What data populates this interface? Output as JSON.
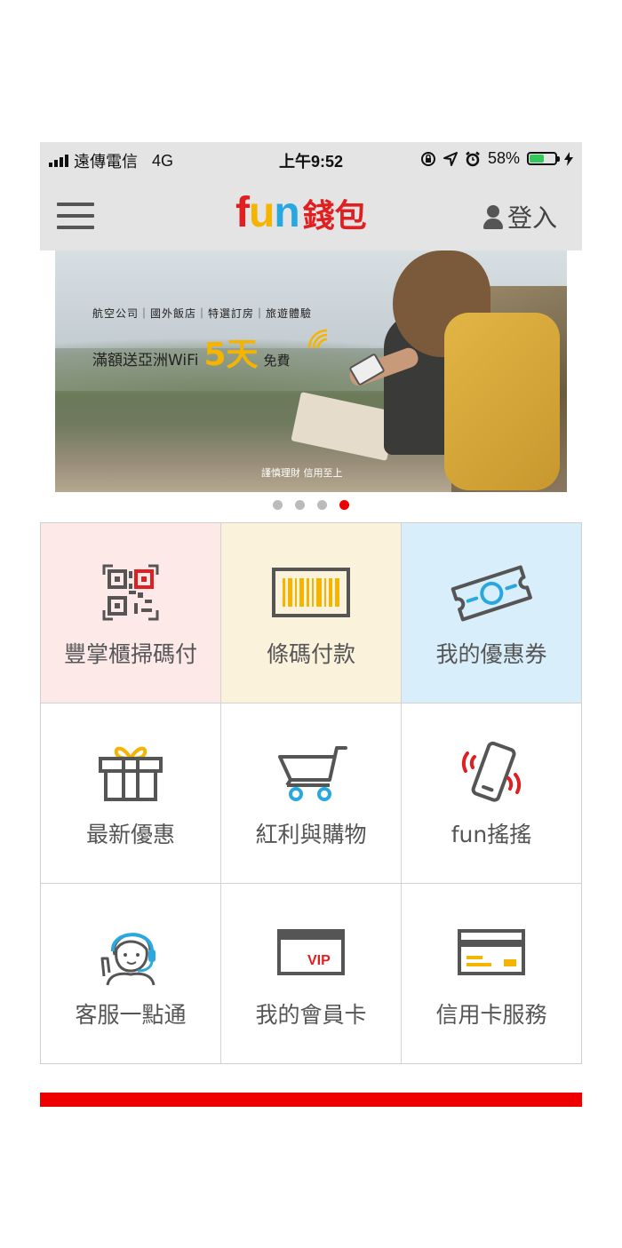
{
  "status_bar": {
    "carrier": "遠傳電信",
    "network": "4G",
    "time": "上午9:52",
    "battery_percent": "58%",
    "battery_level": 0.58
  },
  "header": {
    "menu_icon": "hamburger-menu-icon",
    "logo_fun": "fun",
    "logo_wallet": "錢包",
    "login_label": "登入"
  },
  "banner": {
    "categories": "航空公司｜國外飯店｜特選訂房｜旅遊體驗",
    "promo_prefix": "滿額送亞洲WiFi",
    "promo_days": "5天",
    "promo_suffix": "免費",
    "disclaimer": "謹慎理財 信用至上",
    "slide_count": 4,
    "active_slide": 4
  },
  "menu": [
    {
      "label": "豐掌櫃掃碼付",
      "icon": "qr-code-icon"
    },
    {
      "label": "條碼付款",
      "icon": "barcode-icon"
    },
    {
      "label": "我的優惠券",
      "icon": "coupon-ticket-icon"
    },
    {
      "label": "最新優惠",
      "icon": "gift-box-icon"
    },
    {
      "label": "紅利與購物",
      "icon": "shopping-cart-icon"
    },
    {
      "label": "fun搖搖",
      "icon": "shaking-phone-icon"
    },
    {
      "label": "客服一點通",
      "icon": "customer-service-agent-icon"
    },
    {
      "label": "我的會員卡",
      "icon": "vip-card-icon"
    },
    {
      "label": "信用卡服務",
      "icon": "credit-card-icon"
    }
  ],
  "colors": {
    "brand_red": "#e02020",
    "accent_yellow": "#f5b400",
    "pink_tile": "#fce9e8",
    "cream_tile": "#fbf2dc",
    "blue_tile": "#d8eefb"
  }
}
